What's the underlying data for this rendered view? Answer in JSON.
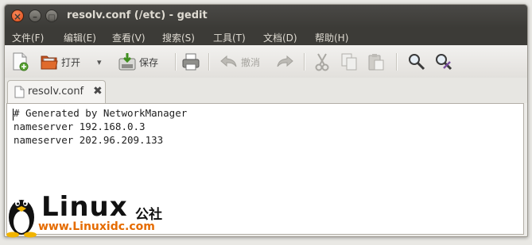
{
  "window": {
    "title": "resolv.conf (/etc) - gedit",
    "close_glyph": "×",
    "min_glyph": "–",
    "max_glyph": "□"
  },
  "menubar": {
    "items": [
      {
        "label": "文件(F)"
      },
      {
        "label": "编辑(E)"
      },
      {
        "label": "查看(V)"
      },
      {
        "label": "搜索(S)"
      },
      {
        "label": "工具(T)"
      },
      {
        "label": "文档(D)"
      },
      {
        "label": "帮助(H)"
      }
    ]
  },
  "toolbar": {
    "open_label": "打开",
    "save_label": "保存",
    "undo_label": "撤消",
    "dropdown_glyph": "▾",
    "icons": [
      "new-document-icon",
      "open-folder-icon",
      "save-icon",
      "print-icon",
      "undo-icon",
      "redo-icon",
      "cut-icon",
      "copy-icon",
      "paste-icon",
      "find-icon",
      "find-replace-icon"
    ]
  },
  "tabs": [
    {
      "label": "resolv.conf",
      "close_glyph": "✖"
    }
  ],
  "editor": {
    "lines": [
      "# Generated by NetworkManager",
      "nameserver 192.168.0.3",
      "nameserver 202.96.209.133"
    ]
  },
  "watermark": {
    "brand": "Linux",
    "suffix": "公社",
    "url": "www.Linuxidc.com"
  },
  "colors": {
    "titlebar": "#3c3b37",
    "close_button": "#df4a16",
    "watermark_url": "#e56b00"
  }
}
